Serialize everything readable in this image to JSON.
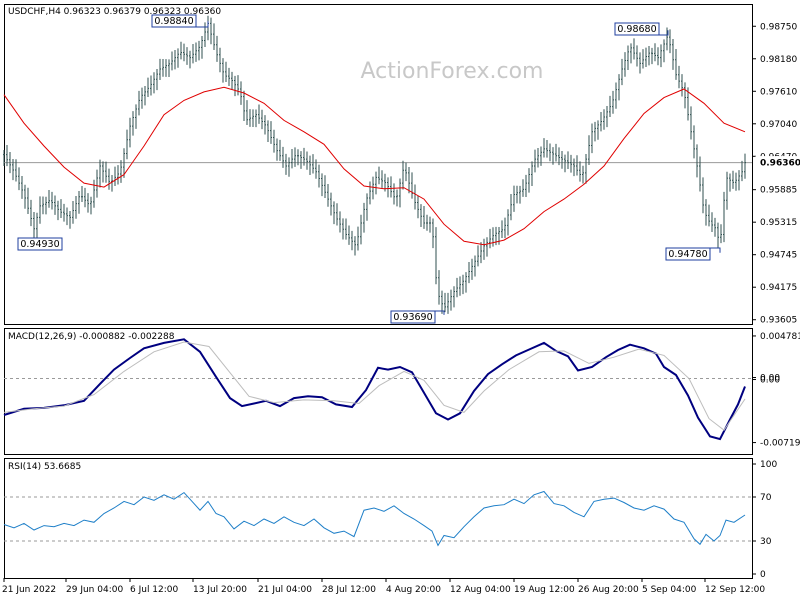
{
  "watermark": "ActionForex.com",
  "colors": {
    "price": "#2f4f4f",
    "ma": "#e00000",
    "macd": "#000080",
    "signal": "#bdbdbd",
    "rsi": "#1e7fc8",
    "frame": "#000000",
    "ref": "#9a9a9a",
    "label_box": "#1f3f9f"
  },
  "chart_data": [
    {
      "type": "candlestick",
      "title": "USDCHF,H4  0.96323 0.96379 0.96323 0.96360",
      "ohlc_label": "USDCHF,H4  0.96323 0.96379 0.96323 0.96360",
      "current_price": 0.9636,
      "current_price_label": "0.96360",
      "ylim": [
        0.936,
        0.99
      ],
      "yticks": [
        "0.98750",
        "0.98180",
        "0.97610",
        "0.97040",
        "0.96470",
        "0.95885",
        "0.95315",
        "0.94745",
        "0.94175",
        "0.93605"
      ],
      "x_labels": [
        "21 Jun 2022",
        "29 Jun 04:00",
        "6 Jul 12:00",
        "13 Jul 20:00",
        "21 Jul 04:00",
        "28 Jul 12:00",
        "4 Aug 20:00",
        "12 Aug 04:00",
        "19 Aug 12:00",
        "26 Aug 20:00",
        "5 Sep 04:00",
        "12 Sep 12:00"
      ],
      "annotations": [
        {
          "label": "0.98840",
          "value": 0.9884,
          "side": "above"
        },
        {
          "label": "0.98680",
          "value": 0.9868,
          "side": "above"
        },
        {
          "label": "0.94930",
          "value": 0.9493,
          "side": "below"
        },
        {
          "label": "0.93690",
          "value": 0.9369,
          "side": "below"
        },
        {
          "label": "0.94780",
          "value": 0.9478,
          "side": "below"
        }
      ],
      "close_path": [
        [
          0,
          0.965
        ],
        [
          10,
          0.962
        ],
        [
          20,
          0.958
        ],
        [
          30,
          0.952
        ],
        [
          36,
          0.956
        ],
        [
          46,
          0.957
        ],
        [
          56,
          0.955
        ],
        [
          66,
          0.954
        ],
        [
          76,
          0.958
        ],
        [
          86,
          0.956
        ],
        [
          96,
          0.963
        ],
        [
          106,
          0.96
        ],
        [
          116,
          0.962
        ],
        [
          126,
          0.97
        ],
        [
          136,
          0.975
        ],
        [
          146,
          0.977
        ],
        [
          156,
          0.98
        ],
        [
          166,
          0.981
        ],
        [
          176,
          0.983
        ],
        [
          186,
          0.982
        ],
        [
          196,
          0.984
        ],
        [
          204,
          0.988
        ],
        [
          212,
          0.983
        ],
        [
          220,
          0.979
        ],
        [
          228,
          0.978
        ],
        [
          236,
          0.976
        ],
        [
          242,
          0.971
        ],
        [
          252,
          0.972
        ],
        [
          262,
          0.97
        ],
        [
          272,
          0.966
        ],
        [
          282,
          0.963
        ],
        [
          292,
          0.965
        ],
        [
          302,
          0.964
        ],
        [
          312,
          0.962
        ],
        [
          322,
          0.958
        ],
        [
          332,
          0.954
        ],
        [
          342,
          0.951
        ],
        [
          352,
          0.949
        ],
        [
          362,
          0.957
        ],
        [
          372,
          0.961
        ],
        [
          382,
          0.96
        ],
        [
          392,
          0.957
        ],
        [
          400,
          0.963
        ],
        [
          410,
          0.957
        ],
        [
          420,
          0.953
        ],
        [
          428,
          0.953
        ],
        [
          433,
          0.941
        ],
        [
          440,
          0.938
        ],
        [
          450,
          0.941
        ],
        [
          460,
          0.943
        ],
        [
          470,
          0.946
        ],
        [
          480,
          0.949
        ],
        [
          490,
          0.951
        ],
        [
          500,
          0.952
        ],
        [
          510,
          0.958
        ],
        [
          520,
          0.959
        ],
        [
          530,
          0.964
        ],
        [
          540,
          0.966
        ],
        [
          550,
          0.965
        ],
        [
          560,
          0.964
        ],
        [
          570,
          0.963
        ],
        [
          578,
          0.961
        ],
        [
          588,
          0.969
        ],
        [
          598,
          0.971
        ],
        [
          608,
          0.974
        ],
        [
          618,
          0.98
        ],
        [
          626,
          0.984
        ],
        [
          636,
          0.981
        ],
        [
          646,
          0.983
        ],
        [
          654,
          0.982
        ],
        [
          664,
          0.986
        ],
        [
          672,
          0.979
        ],
        [
          680,
          0.976
        ],
        [
          688,
          0.968
        ],
        [
          694,
          0.962
        ],
        [
          700,
          0.955
        ],
        [
          706,
          0.953
        ],
        [
          712,
          0.952
        ],
        [
          716,
          0.949
        ],
        [
          722,
          0.961
        ],
        [
          730,
          0.96
        ],
        [
          738,
          0.962
        ],
        [
          741,
          0.9636
        ]
      ],
      "ma_path": [
        [
          0,
          0.9755
        ],
        [
          20,
          0.9705
        ],
        [
          40,
          0.9665
        ],
        [
          60,
          0.9628
        ],
        [
          80,
          0.96
        ],
        [
          100,
          0.9593
        ],
        [
          120,
          0.9615
        ],
        [
          140,
          0.9665
        ],
        [
          160,
          0.972
        ],
        [
          180,
          0.9745
        ],
        [
          200,
          0.976
        ],
        [
          220,
          0.9768
        ],
        [
          240,
          0.9758
        ],
        [
          260,
          0.974
        ],
        [
          280,
          0.971
        ],
        [
          300,
          0.969
        ],
        [
          320,
          0.9668
        ],
        [
          340,
          0.9625
        ],
        [
          360,
          0.9595
        ],
        [
          380,
          0.959
        ],
        [
          400,
          0.9592
        ],
        [
          420,
          0.9572
        ],
        [
          440,
          0.9528
        ],
        [
          460,
          0.9498
        ],
        [
          480,
          0.9492
        ],
        [
          500,
          0.95
        ],
        [
          520,
          0.952
        ],
        [
          540,
          0.955
        ],
        [
          560,
          0.9572
        ],
        [
          580,
          0.9598
        ],
        [
          600,
          0.963
        ],
        [
          620,
          0.9678
        ],
        [
          640,
          0.9722
        ],
        [
          660,
          0.975
        ],
        [
          680,
          0.9765
        ],
        [
          700,
          0.974
        ],
        [
          720,
          0.9705
        ],
        [
          741,
          0.969
        ]
      ]
    },
    {
      "type": "line",
      "title": "MACD(12,26,9) -0.000882 -0.002288",
      "ylim": [
        -0.0078,
        0.005
      ],
      "yticks": [
        "0.004781",
        "0.00",
        "0.00",
        "-0.007191"
      ],
      "series": [
        {
          "name": "MACD",
          "key": "macd",
          "values": [
            [
              0,
              -0.0041
            ],
            [
              20,
              -0.0034
            ],
            [
              40,
              -0.0033
            ],
            [
              60,
              -0.003
            ],
            [
              80,
              -0.0025
            ],
            [
              96,
              -0.0006
            ],
            [
              110,
              0.001
            ],
            [
              126,
              0.0023
            ],
            [
              140,
              0.0034
            ],
            [
              160,
              0.004
            ],
            [
              180,
              0.0044
            ],
            [
              196,
              0.003
            ],
            [
              212,
              0.0002
            ],
            [
              226,
              -0.0022
            ],
            [
              238,
              -0.0031
            ],
            [
              250,
              -0.0028
            ],
            [
              262,
              -0.0025
            ],
            [
              276,
              -0.0031
            ],
            [
              290,
              -0.0022
            ],
            [
              304,
              -0.002
            ],
            [
              318,
              -0.0021
            ],
            [
              332,
              -0.0029
            ],
            [
              348,
              -0.0032
            ],
            [
              362,
              -0.0013
            ],
            [
              374,
              0.0012
            ],
            [
              384,
              0.001
            ],
            [
              396,
              0.0013
            ],
            [
              408,
              0.0007
            ],
            [
              420,
              -0.0016
            ],
            [
              432,
              -0.0039
            ],
            [
              444,
              -0.0046
            ],
            [
              456,
              -0.0039
            ],
            [
              470,
              -0.0014
            ],
            [
              484,
              0.0005
            ],
            [
              498,
              0.0016
            ],
            [
              512,
              0.0026
            ],
            [
              526,
              0.0033
            ],
            [
              540,
              0.004
            ],
            [
              552,
              0.0031
            ],
            [
              564,
              0.0025
            ],
            [
              574,
              0.0009
            ],
            [
              588,
              0.0013
            ],
            [
              602,
              0.0024
            ],
            [
              614,
              0.0032
            ],
            [
              626,
              0.0038
            ],
            [
              640,
              0.0034
            ],
            [
              652,
              0.0028
            ],
            [
              660,
              0.0013
            ],
            [
              672,
              0.0004
            ],
            [
              684,
              -0.0019
            ],
            [
              694,
              -0.0044
            ],
            [
              706,
              -0.0065
            ],
            [
              716,
              -0.0068
            ],
            [
              726,
              -0.0046
            ],
            [
              734,
              -0.0029
            ],
            [
              741,
              -0.0009
            ]
          ]
        },
        {
          "name": "Signal",
          "key": "signal",
          "values": [
            [
              0,
              -0.0038
            ],
            [
              30,
              -0.0034
            ],
            [
              60,
              -0.0031
            ],
            [
              90,
              -0.0018
            ],
            [
              120,
              0.0008
            ],
            [
              150,
              0.003
            ],
            [
              180,
              0.0041
            ],
            [
              205,
              0.0036
            ],
            [
              225,
              0.0008
            ],
            [
              245,
              -0.002
            ],
            [
              270,
              -0.0027
            ],
            [
              300,
              -0.0024
            ],
            [
              330,
              -0.0025
            ],
            [
              355,
              -0.0028
            ],
            [
              375,
              -0.0008
            ],
            [
              400,
              0.0008
            ],
            [
              420,
              -0.0002
            ],
            [
              440,
              -0.003
            ],
            [
              460,
              -0.0038
            ],
            [
              480,
              -0.0014
            ],
            [
              505,
              0.001
            ],
            [
              535,
              0.003
            ],
            [
              560,
              0.0031
            ],
            [
              585,
              0.0017
            ],
            [
              610,
              0.0024
            ],
            [
              635,
              0.0033
            ],
            [
              660,
              0.0026
            ],
            [
              685,
              0.0
            ],
            [
              705,
              -0.0045
            ],
            [
              720,
              -0.0058
            ],
            [
              741,
              -0.0023
            ]
          ]
        }
      ]
    },
    {
      "type": "line",
      "title": "RSI(14) 53.6685",
      "ylim": [
        0,
        100
      ],
      "yticks": [
        "100",
        "70",
        "30",
        "0"
      ],
      "series": [
        {
          "name": "RSI",
          "key": "rsi",
          "values": [
            [
              0,
              45
            ],
            [
              10,
              42
            ],
            [
              20,
              46
            ],
            [
              30,
              40
            ],
            [
              40,
              44
            ],
            [
              50,
              43
            ],
            [
              60,
              46
            ],
            [
              70,
              44
            ],
            [
              80,
              49
            ],
            [
              90,
              47
            ],
            [
              100,
              55
            ],
            [
              110,
              60
            ],
            [
              120,
              66
            ],
            [
              130,
              63
            ],
            [
              140,
              70
            ],
            [
              150,
              67
            ],
            [
              160,
              72
            ],
            [
              170,
              68
            ],
            [
              180,
              74
            ],
            [
              190,
              64
            ],
            [
              196,
              58
            ],
            [
              204,
              66
            ],
            [
              212,
              55
            ],
            [
              220,
              52
            ],
            [
              230,
              41
            ],
            [
              240,
              48
            ],
            [
              250,
              44
            ],
            [
              260,
              50
            ],
            [
              270,
              46
            ],
            [
              280,
              52
            ],
            [
              290,
              47
            ],
            [
              300,
              44
            ],
            [
              310,
              50
            ],
            [
              320,
              42
            ],
            [
              330,
              37
            ],
            [
              340,
              39
            ],
            [
              350,
              34
            ],
            [
              360,
              58
            ],
            [
              370,
              60
            ],
            [
              380,
              57
            ],
            [
              390,
              62
            ],
            [
              400,
              55
            ],
            [
              410,
              50
            ],
            [
              420,
              44
            ],
            [
              428,
              39
            ],
            [
              434,
              26
            ],
            [
              440,
              35
            ],
            [
              450,
              33
            ],
            [
              460,
              43
            ],
            [
              470,
              52
            ],
            [
              480,
              60
            ],
            [
              490,
              62
            ],
            [
              500,
              63
            ],
            [
              510,
              68
            ],
            [
              520,
              64
            ],
            [
              530,
              72
            ],
            [
              540,
              75
            ],
            [
              550,
              64
            ],
            [
              560,
              62
            ],
            [
              570,
              56
            ],
            [
              580,
              52
            ],
            [
              590,
              66
            ],
            [
              600,
              68
            ],
            [
              610,
              69
            ],
            [
              620,
              65
            ],
            [
              630,
              60
            ],
            [
              640,
              58
            ],
            [
              650,
              62
            ],
            [
              660,
              59
            ],
            [
              670,
              50
            ],
            [
              680,
              47
            ],
            [
              690,
              32
            ],
            [
              696,
              27
            ],
            [
              702,
              36
            ],
            [
              710,
              30
            ],
            [
              716,
              35
            ],
            [
              722,
              49
            ],
            [
              730,
              47
            ],
            [
              741,
              53.67
            ]
          ]
        }
      ],
      "current_value": 53.6685
    }
  ]
}
